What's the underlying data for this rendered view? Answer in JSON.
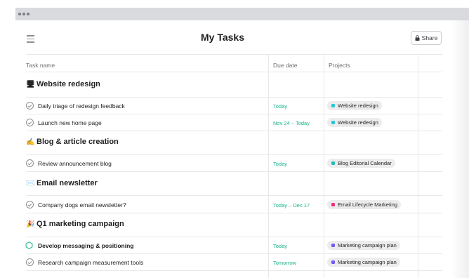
{
  "colors": {
    "website_redesign": "#26c6d9",
    "blog_calendar": "#1fc0b5",
    "email_lifecycle": "#ec2f7b",
    "marketing_plan": "#6e5bf2",
    "due_green": "#18b38a"
  },
  "header": {
    "title": "My Tasks",
    "share_label": "Share",
    "menu_icon": "hamburger-icon",
    "share_icon": "lock-icon"
  },
  "columns": {
    "task": "Task name",
    "due": "Due date",
    "projects": "Projects"
  },
  "sections": [
    {
      "title": "Website redesign",
      "emoji": "🖥",
      "tasks": [
        {
          "name": "Daily triage of redesign feedback",
          "due": "Today",
          "project": "Website redesign"
        },
        {
          "name": "Launch new home page",
          "due": "Nov 24 – Today",
          "project": "Website redesign"
        }
      ]
    },
    {
      "title": "Blog & article creation",
      "emoji": "✍️",
      "tasks": [
        {
          "name": "Review announcement blog",
          "due": "Today",
          "project": "Blog Editorial Calendar"
        }
      ]
    },
    {
      "title": "Email newsletter",
      "emoji": "✉️",
      "tasks": [
        {
          "name": "Company dogs email newsletter?",
          "due": "Today – Dec 17",
          "project": "Email Lifecycle Marketing"
        }
      ]
    },
    {
      "title": "Q1 marketing campaign",
      "emoji": "🎉",
      "tasks": [
        {
          "name": "Develop messaging & positioning",
          "due": "Today",
          "project": "Marketing campaign plan"
        },
        {
          "name": "Research campaign measurement tools",
          "due": "Tomorrow",
          "project": "Marketing campaign plan"
        }
      ]
    }
  ]
}
